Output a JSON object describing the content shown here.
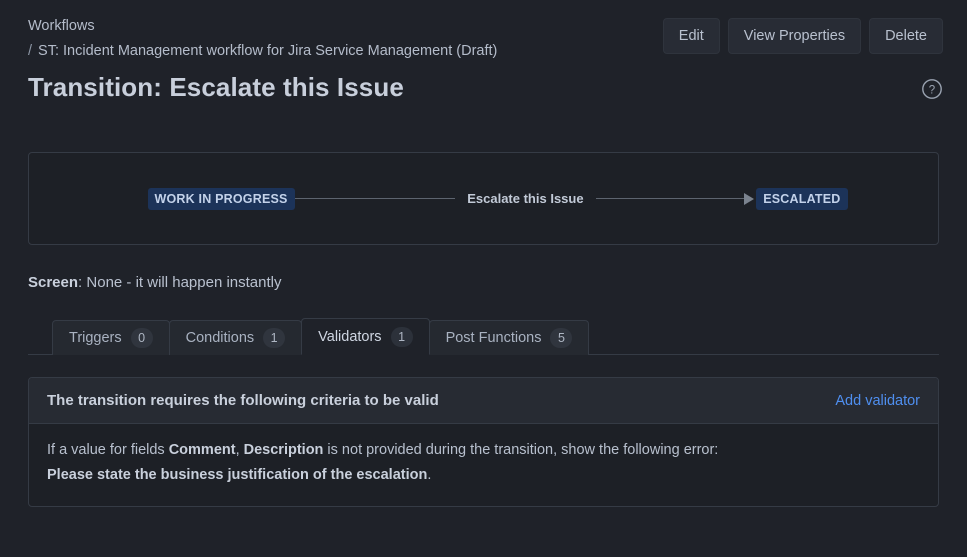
{
  "header": {
    "breadcrumb": {
      "root": "Workflows",
      "separator": "/",
      "current": "ST: Incident Management workflow for Jira Service Management (Draft)"
    },
    "page_title": "Transition: Escalate this Issue",
    "buttons": [
      {
        "label": "Edit",
        "name": "edit-button"
      },
      {
        "label": "View Properties",
        "name": "view-properties-button"
      },
      {
        "label": "Delete",
        "name": "delete-button"
      }
    ],
    "help_icon": "help-circle-icon"
  },
  "diagram": {
    "from_status": "WORK IN PROGRESS",
    "transition_label": "Escalate this Issue",
    "to_status": "ESCALATED",
    "status_bg": "#1c3359",
    "status_fg": "#c3d2ea"
  },
  "screen": {
    "label": "Screen",
    "separator": ": ",
    "value": "None - it will happen instantly"
  },
  "tabs": [
    {
      "label": "Triggers",
      "count": "0",
      "active": false
    },
    {
      "label": "Conditions",
      "count": "1",
      "active": false
    },
    {
      "label": "Validators",
      "count": "1",
      "active": true
    },
    {
      "label": "Post Functions",
      "count": "5",
      "active": false
    }
  ],
  "validator_panel": {
    "title": "The transition requires the following criteria to be valid",
    "add_link": "Add validator",
    "body": {
      "prefix": "If a value for fields ",
      "field_1": "Comment",
      "field_separator": ", ",
      "field_2": "Description",
      "middle": " is not provided during the transition, show the following error:",
      "error_message": "Please state the business justification of the escalation",
      "period": "."
    }
  },
  "colors": {
    "page_background": "#1f2229",
    "panel_background": "#1d2026",
    "panel_header_background": "#272b33",
    "border": "#353b45",
    "link": "#4f8ff0",
    "text_primary": "#c9d0dc",
    "text_secondary": "#b8c0ce"
  }
}
